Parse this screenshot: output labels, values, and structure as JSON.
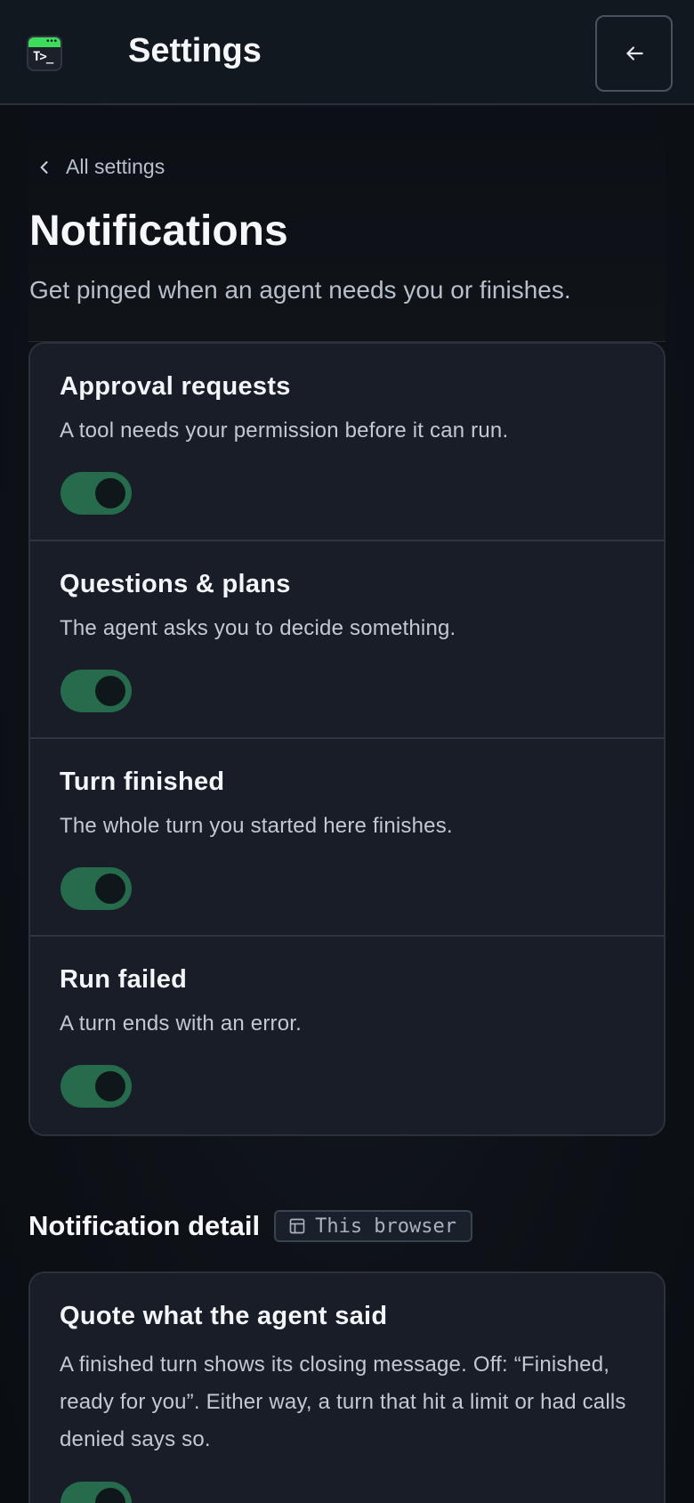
{
  "header": {
    "title": "Settings",
    "logo_icon": "terminal-app-icon",
    "back_icon": "arrow-left-icon"
  },
  "intro": {
    "breadcrumb": "All settings",
    "title": "Notifications",
    "subtitle": "Get pinged when an agent needs you or finishes."
  },
  "notifications": [
    {
      "title": "Approval requests",
      "description": "A tool needs your permission before it can run.",
      "enabled": true
    },
    {
      "title": "Questions & plans",
      "description": "The agent asks you to decide something.",
      "enabled": true
    },
    {
      "title": "Turn finished",
      "description": "The whole turn you started here finishes.",
      "enabled": true
    },
    {
      "title": "Run failed",
      "description": "A turn ends with an error.",
      "enabled": true
    }
  ],
  "detail": {
    "title": "Notification detail",
    "badge": "This browser",
    "badge_icon": "browser-window-icon",
    "items": [
      {
        "title": "Quote what the agent said",
        "description": "A finished turn shows its closing message. Off: “Finished, ready for you”. Either way, a turn that hit a limit or had calls denied says so.",
        "enabled": true
      }
    ]
  },
  "colors": {
    "accent_green": "#256b4c",
    "logo_green": "#3ddc5c",
    "card_bg": "#181d27",
    "page_bg": "#0d1117"
  }
}
